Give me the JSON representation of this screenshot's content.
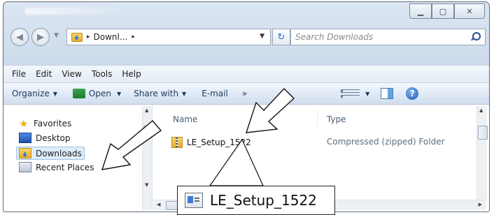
{
  "explorer": {
    "address": {
      "crumb": "Downl...",
      "sep_before": "▸",
      "sep_after": "▸"
    },
    "search": {
      "placeholder": "Search Downloads"
    },
    "menu": [
      {
        "label": "File"
      },
      {
        "label": "Edit"
      },
      {
        "label": "View"
      },
      {
        "label": "Tools"
      },
      {
        "label": "Help"
      }
    ],
    "toolbar": {
      "organize_label": "Organize",
      "open_label": "Open",
      "share_label": "Share with",
      "email_label": "E-mail",
      "more_label": "»"
    },
    "nav": {
      "favorites_label": "Favorites",
      "desktop_label": "Desktop",
      "downloads_label": "Downloads",
      "recent_label": "Recent Places"
    },
    "columns": {
      "name": "Name",
      "type": "Type"
    },
    "files": [
      {
        "name": "LE_Setup_1522",
        "type": "Compressed (zipped) Folder"
      }
    ]
  },
  "callout": {
    "label": "LE_Setup_1522"
  }
}
